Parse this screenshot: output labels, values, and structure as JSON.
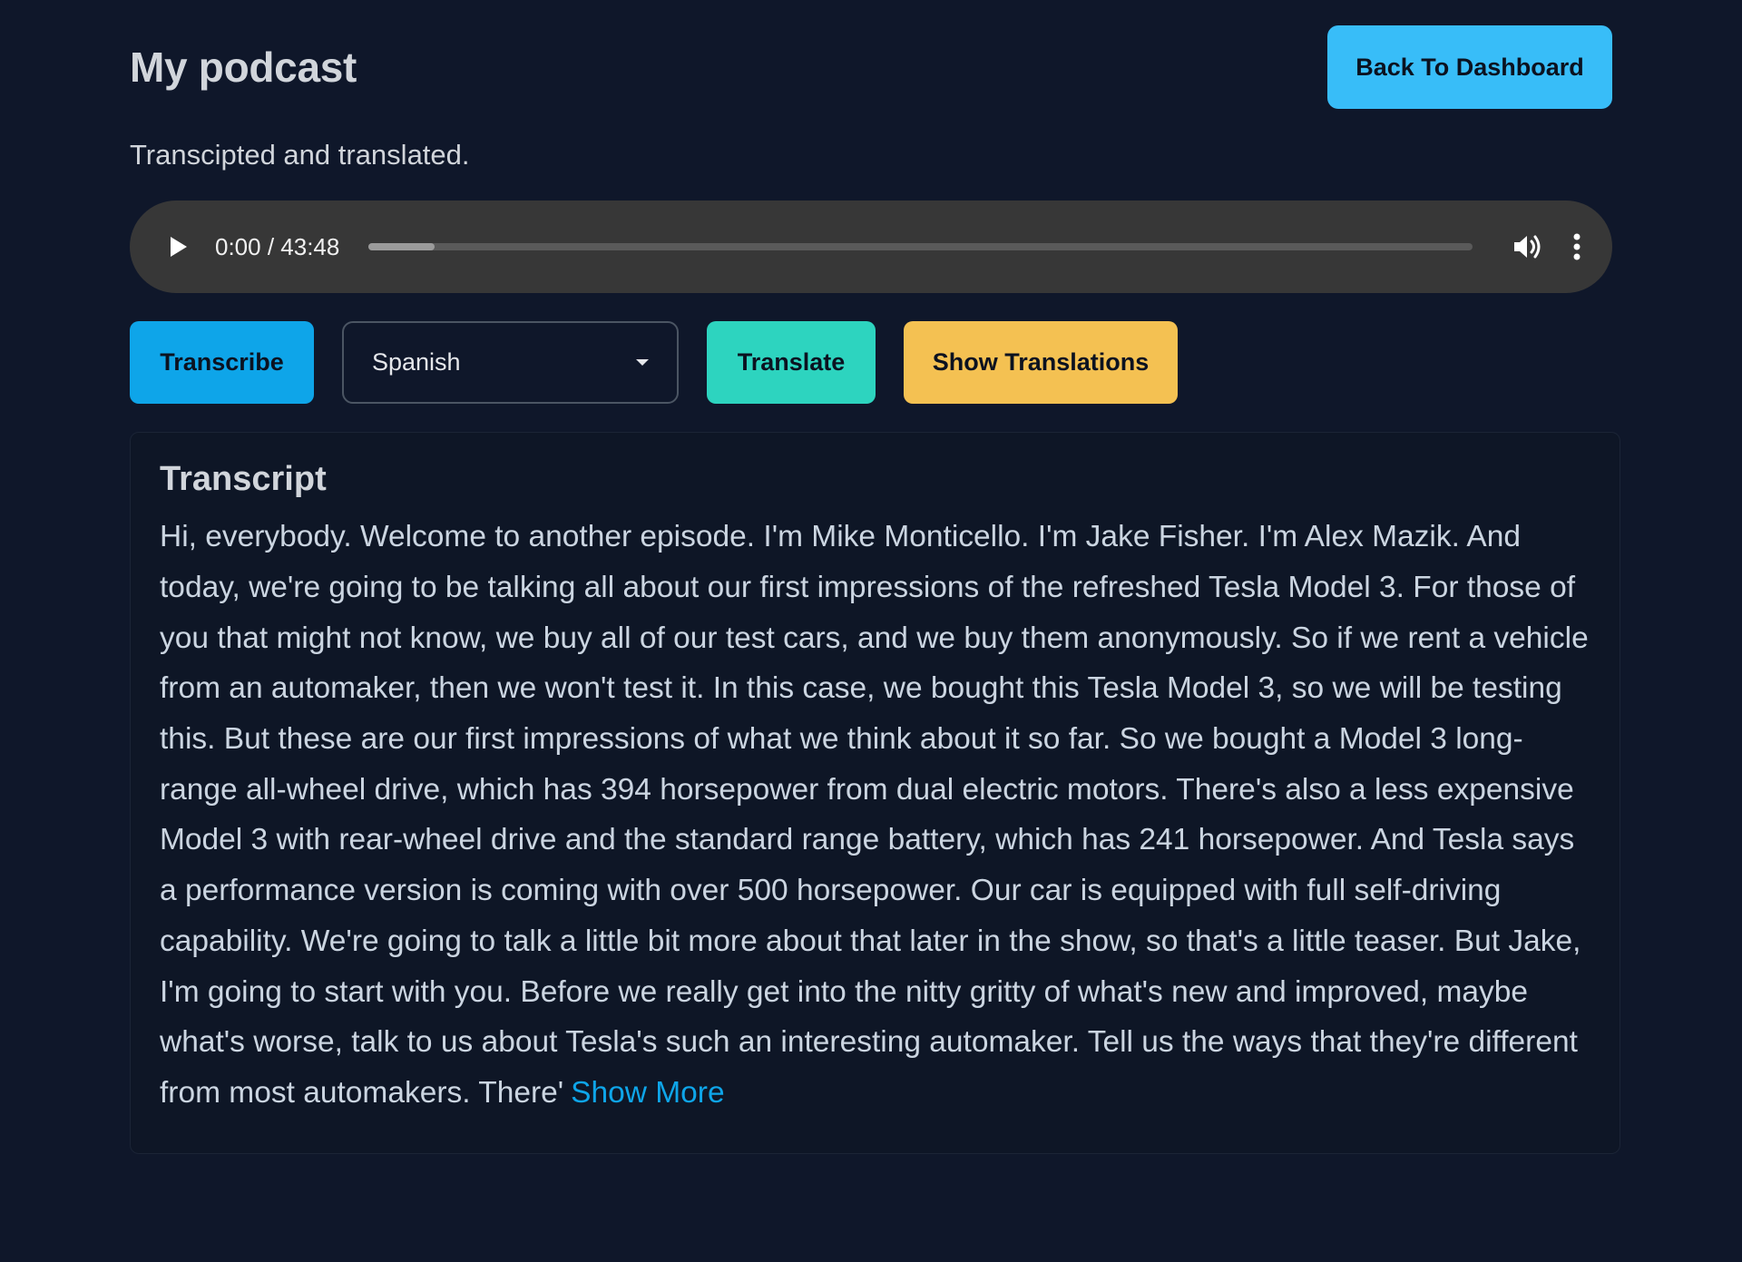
{
  "header": {
    "title": "My podcast",
    "back_label": "Back To Dashboard"
  },
  "subtitle": "Transcipted and translated.",
  "audio": {
    "time": "0:00 / 43:48",
    "icons": [
      "play-icon",
      "volume-icon",
      "more-vertical-icon"
    ]
  },
  "controls": {
    "transcribe_label": "Transcribe",
    "language_selected": "Spanish",
    "translate_label": "Translate",
    "show_translations_label": "Show Translations"
  },
  "transcript": {
    "title": "Transcript",
    "text": "Hi, everybody. Welcome to another episode. I'm Mike Monticello. I'm Jake Fisher. I'm Alex Mazik. And today, we're going to be talking all about our first impressions of the refreshed Tesla Model 3. For those of you that might not know, we buy all of our test cars, and we buy them anonymously. So if we rent a vehicle from an automaker, then we won't test it. In this case, we bought this Tesla Model 3, so we will be testing this. But these are our first impressions of what we think about it so far. So we bought a Model 3 long-range all-wheel drive, which has 394 horsepower from dual electric motors. There's also a less expensive Model 3 with rear-wheel drive and the standard range battery, which has 241 horsepower. And Tesla says a performance version is coming with over 500 horsepower. Our car is equipped with full self-driving capability. We're going to talk a little bit more about that later in the show, so that's a little teaser. But Jake, I'm going to start with you. Before we really get into the nitty gritty of what's new and improved, maybe what's worse, talk to us about Tesla's such an interesting automaker. Tell us the ways that they're different from most automakers. There'",
    "show_more_label": "Show More"
  },
  "colors": {
    "background": "#0f172a",
    "back_button": "#38bdf8",
    "transcribe_button": "#0ea5e9",
    "translate_button": "#2dd4bf",
    "show_translations_button": "#f4c152",
    "link": "#0ea5e9"
  }
}
